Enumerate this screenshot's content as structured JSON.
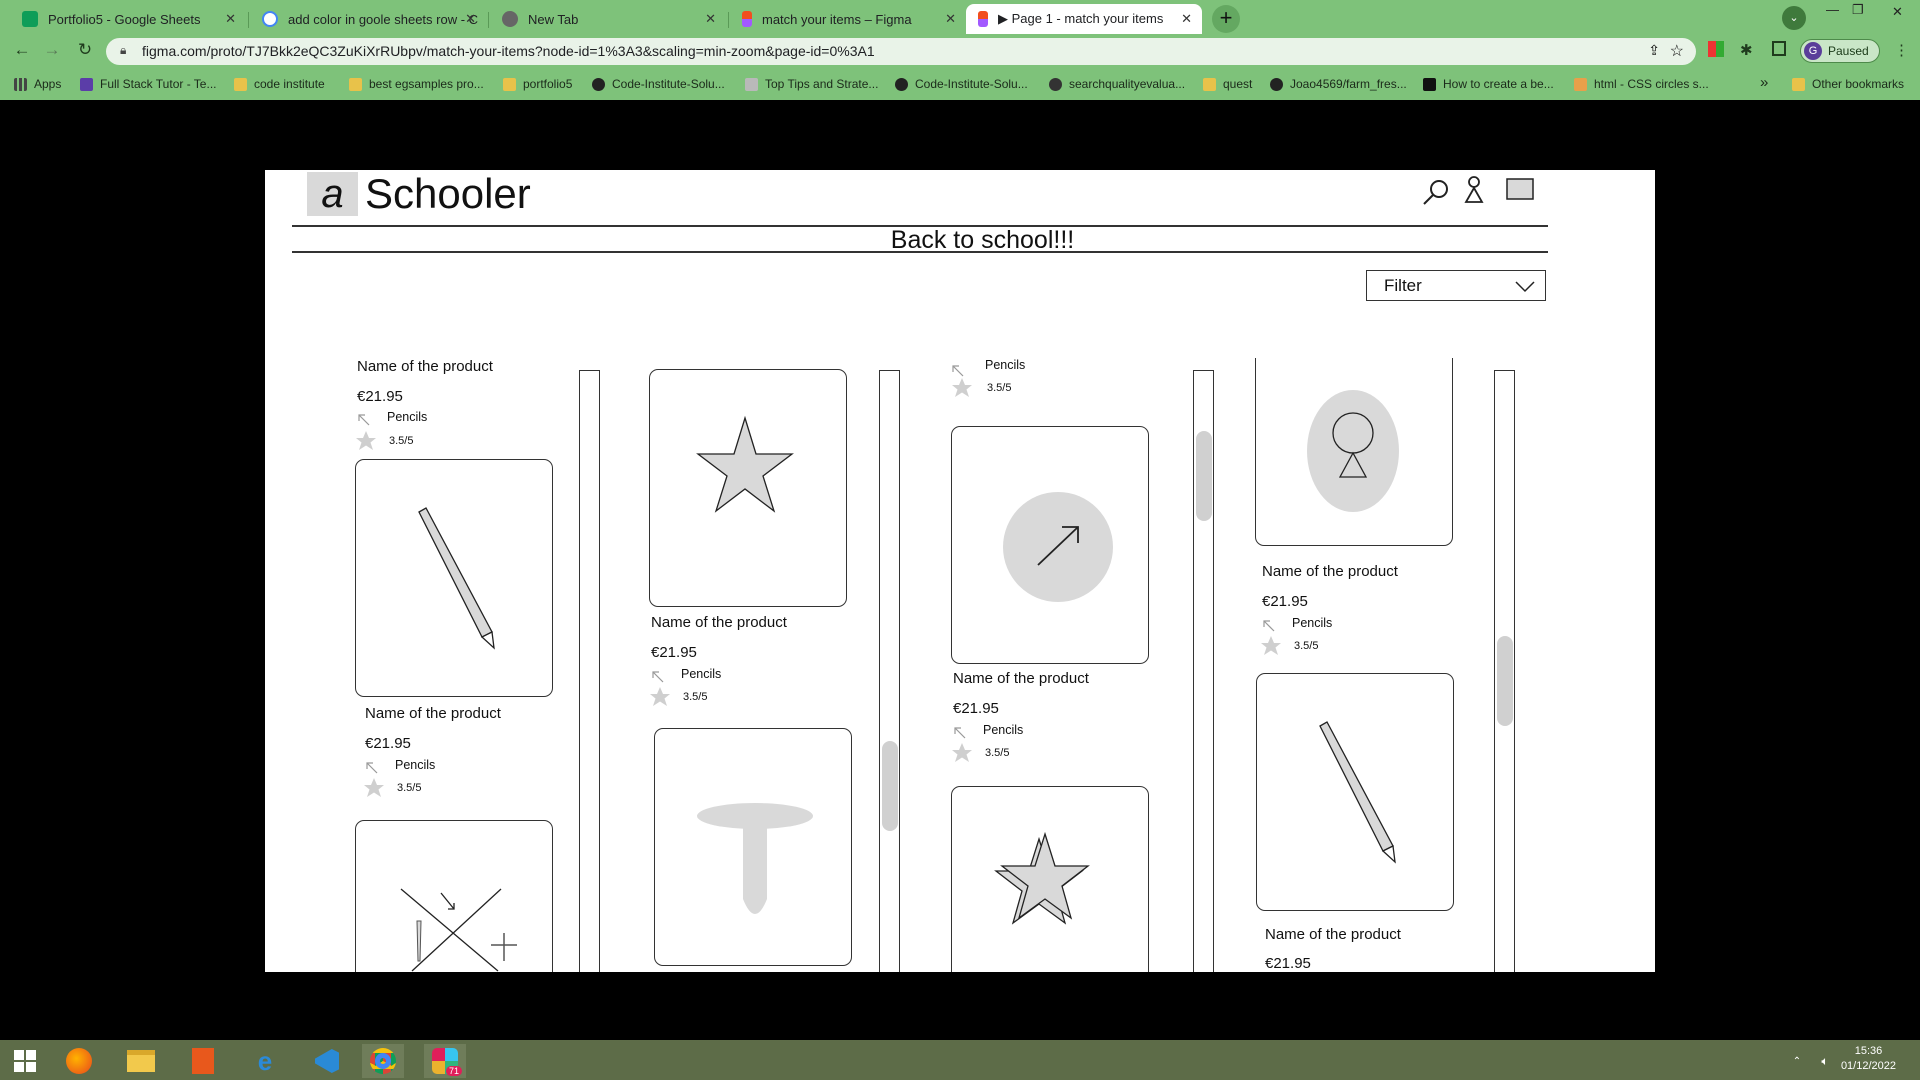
{
  "browser": {
    "tabs": [
      {
        "title": "Portfolio5 - Google Sheets",
        "icon": "sheets-icon",
        "color": "#0f9d58"
      },
      {
        "title": "add color in goole sheets row - C",
        "icon": "google-icon",
        "color": "#4285f4"
      },
      {
        "title": "New Tab",
        "icon": "chrome-icon",
        "color": "#666666"
      },
      {
        "title": "match your items – Figma",
        "icon": "figma-icon",
        "color": "#f24e1e"
      },
      {
        "title": "▶ Page 1 - match your items",
        "icon": "figma-icon",
        "color": "#f24e1e",
        "active": true
      }
    ],
    "url": "figma.com/proto/TJ7Bkk2eQC3ZuKiXrRUbpv/match-your-items?node-id=1%3A3&scaling=min-zoom&page-id=0%3A1",
    "profile_label": "Paused",
    "profile_initial": "G",
    "bookmarks": [
      {
        "label": "Apps",
        "color": "#444444"
      },
      {
        "label": "Full Stack Tutor - Te...",
        "color": "#5b3da8"
      },
      {
        "label": "code institute",
        "color": "#e8c24a"
      },
      {
        "label": "best egsamples pro...",
        "color": "#e8c24a"
      },
      {
        "label": "portfolio5",
        "color": "#e8c24a"
      },
      {
        "label": "Code-Institute-Solu...",
        "color": "#222222"
      },
      {
        "label": "Top Tips and Strate...",
        "color": "#b9b9b9"
      },
      {
        "label": "Code-Institute-Solu...",
        "color": "#222222"
      },
      {
        "label": "searchqualityevalua...",
        "color": "#333333"
      },
      {
        "label": "quest",
        "color": "#e8c24a"
      },
      {
        "label": "Joao4569/farm_fres...",
        "color": "#222222"
      },
      {
        "label": "How to create a be...",
        "color": "#111111"
      },
      {
        "label": "html - CSS circles s...",
        "color": "#e8a04a"
      }
    ],
    "bookmarks_overflow": "»",
    "other_bookmarks": "Other bookmarks"
  },
  "site": {
    "logo_letter": "a",
    "logo_text": "Schooler",
    "banner": "Back to school!!!",
    "filter_label": "Filter"
  },
  "products": [
    {
      "name": "Name of the product",
      "price": "€21.95",
      "category": "Pencils",
      "rating": "3.5/5"
    },
    {
      "name": "Name of the product",
      "price": "€21.95",
      "category": "Pencils",
      "rating": "3.5/5"
    },
    {
      "name": "Name of the product",
      "price": "€21.95",
      "category": "Pencils",
      "rating": "3.5/5"
    },
    {
      "name": "Name of the product",
      "price": "€21.95",
      "category": "Pencils",
      "rating": "3.5/5"
    },
    {
      "name": "Name of the product",
      "price": "€21.95",
      "category": "Pencils",
      "rating": "3.5/5"
    },
    {
      "name": "Name of the product",
      "price": "€21.95",
      "category": "Pencils",
      "rating": "3.5/5"
    },
    {
      "name": "Name of the product",
      "price": "€21.95",
      "category": "Pencils",
      "rating": "3.5/5"
    },
    {
      "name": "Name of the product",
      "price": "€21.95"
    }
  ],
  "taskbar": {
    "time": "15:36",
    "date": "01/12/2022",
    "slack_badge": "71"
  },
  "colors": {
    "chrome_green": "#7ec27a",
    "placeholder_gray": "#d9d9d9"
  }
}
